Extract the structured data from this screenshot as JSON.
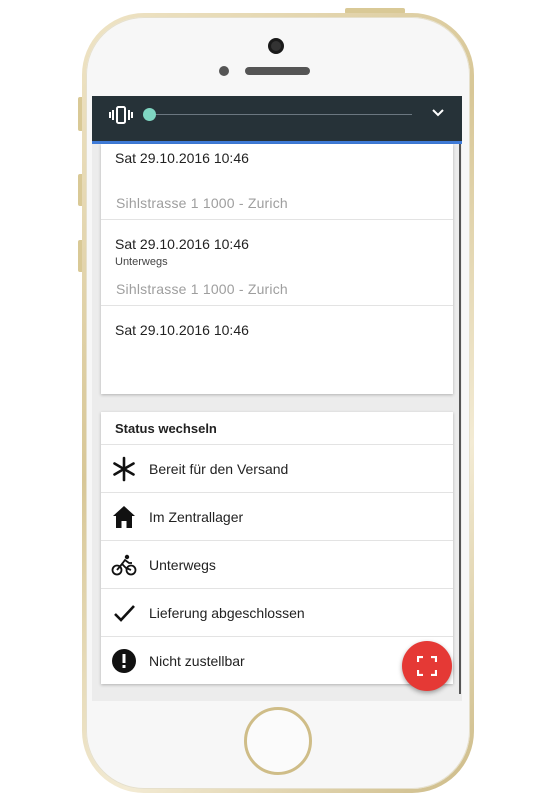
{
  "history": [
    {
      "date": "Sat 29.10.2016 10:46",
      "status": "",
      "address": "Sihlstrasse  1 1000 - Zurich"
    },
    {
      "date": "Sat 29.10.2016 10:46",
      "status": "Unterwegs",
      "address": "Sihlstrasse  1 1000 - Zurich"
    },
    {
      "date": "Sat 29.10.2016 10:46",
      "status": "",
      "address": ""
    }
  ],
  "status_panel": {
    "title": "Status wechseln",
    "items": [
      {
        "label": "Bereit für den Versand",
        "icon": "asterisk-icon"
      },
      {
        "label": "Im Zentrallager",
        "icon": "home-icon"
      },
      {
        "label": "Unterwegs",
        "icon": "bike-icon"
      },
      {
        "label": "Lieferung abgeschlossen",
        "icon": "check-icon"
      },
      {
        "label": "Nicht zustellbar",
        "icon": "alert-icon"
      }
    ]
  },
  "colors": {
    "topbar": "#263238",
    "accent_line": "#3f7bd8",
    "slider_thumb": "#7fd6c2",
    "fab": "#e53935"
  },
  "fab_icon": "scan-frame-icon",
  "topbar_icons": [
    "vibrate-icon",
    "chevron-down-icon"
  ]
}
